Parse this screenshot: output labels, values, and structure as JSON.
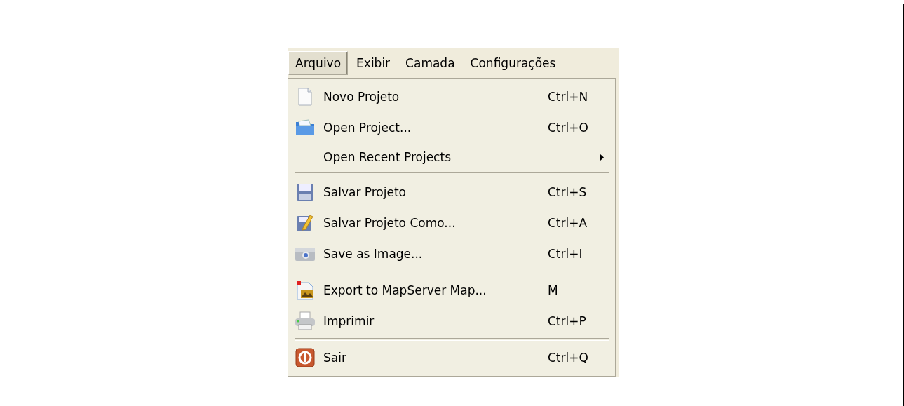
{
  "menubar": [
    {
      "label": "Arquivo",
      "selected": true
    },
    {
      "label": "Exibir",
      "selected": false
    },
    {
      "label": "Camada",
      "selected": false
    },
    {
      "label": "Configurações",
      "selected": false
    }
  ],
  "menu": [
    {
      "kind": "item",
      "label": "Novo Projeto",
      "shortcut": "Ctrl+N"
    },
    {
      "kind": "item",
      "label": "Open Project...",
      "shortcut": "Ctrl+O"
    },
    {
      "kind": "submenu",
      "label": "Open Recent Projects"
    },
    {
      "kind": "separator"
    },
    {
      "kind": "item",
      "label": "Salvar Projeto",
      "shortcut": "Ctrl+S"
    },
    {
      "kind": "item",
      "label": "Salvar Projeto Como...",
      "shortcut": "Ctrl+A"
    },
    {
      "kind": "item",
      "label": "Save as Image...",
      "shortcut": "Ctrl+I"
    },
    {
      "kind": "separator"
    },
    {
      "kind": "item",
      "label": "Export to MapServer Map...",
      "shortcut": "M"
    },
    {
      "kind": "item",
      "label": "Imprimir",
      "shortcut": "Ctrl+P"
    },
    {
      "kind": "separator"
    },
    {
      "kind": "item",
      "label": "Sair",
      "shortcut": "Ctrl+Q"
    }
  ]
}
